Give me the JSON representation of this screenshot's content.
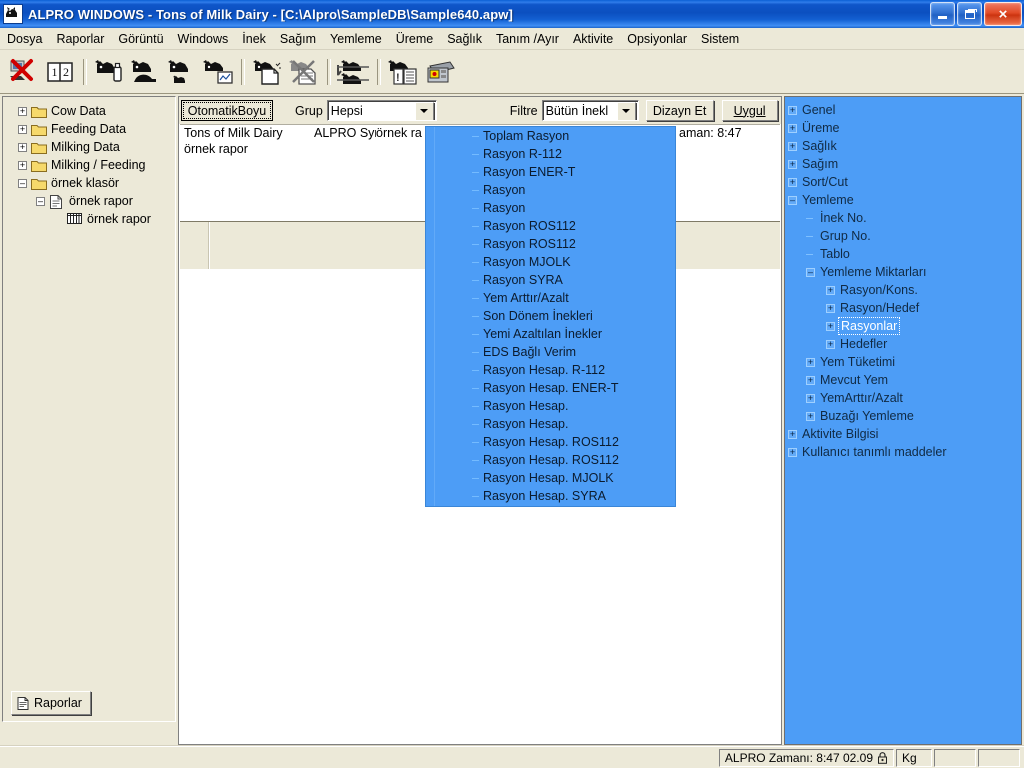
{
  "window": {
    "title": "ALPRO WINDOWS - Tons of Milk Dairy - [C:\\Alpro\\SampleDB\\Sample640.apw]",
    "icon": "alpro-cow-icon",
    "minimize_label": "",
    "maximize_label": "",
    "close_label": "×"
  },
  "menubar": {
    "items": [
      {
        "label": "Dosya"
      },
      {
        "label": "Raporlar"
      },
      {
        "label": "Görüntü"
      },
      {
        "label": "Windows"
      },
      {
        "label": "İnek"
      },
      {
        "label": "Sağım"
      },
      {
        "label": "Yemleme"
      },
      {
        "label": "Üreme"
      },
      {
        "label": "Sağlık"
      },
      {
        "label": "Tanım /Ayır"
      },
      {
        "label": "Aktivite"
      },
      {
        "label": "Opsiyonlar"
      },
      {
        "label": "Sistem"
      }
    ]
  },
  "toolbar": {
    "buttons": [
      {
        "name": "delete-report-icon"
      },
      {
        "name": "numbered-book-icon"
      },
      {
        "name": "cow-bottle-icon"
      },
      {
        "name": "cow-feed-icon"
      },
      {
        "name": "cow-calf-icon"
      },
      {
        "name": "cow-chart-icon"
      },
      {
        "name": "cow-new-document-icon"
      },
      {
        "name": "cow-delete-document-icon"
      },
      {
        "name": "cow-sort-icon"
      },
      {
        "name": "cow-report-list-icon"
      },
      {
        "name": "calculator-icon"
      }
    ]
  },
  "left_tree": {
    "nodes": [
      {
        "label": "Cow Data",
        "expander": "+",
        "type": "folder",
        "indent": 0
      },
      {
        "label": "Feeding Data",
        "expander": "+",
        "type": "folder",
        "indent": 0
      },
      {
        "label": "Milking Data",
        "expander": "+",
        "type": "folder",
        "indent": 0
      },
      {
        "label": "Milking / Feeding",
        "expander": "+",
        "type": "folder",
        "indent": 0
      },
      {
        "label": "örnek klasör",
        "expander": "–",
        "type": "folder",
        "indent": 0
      },
      {
        "label": "örnek rapor",
        "expander": "–",
        "type": "page",
        "indent": 1
      },
      {
        "label": "örnek rapor",
        "expander": "",
        "type": "grid",
        "indent": 2
      }
    ],
    "bottom_button": {
      "label": "Raporlar",
      "icon": "page-icon"
    }
  },
  "report_toolbar": {
    "autosize_button": "OtomatikBoyu",
    "group_label": "Grup",
    "group_value": "Hepsi",
    "filter_label": "Filtre",
    "filter_value": "Bütün İnekl",
    "design_button": "Dizayn Et",
    "apply_button": "Uygul"
  },
  "report_header": {
    "line1": [
      "Tons of Milk Dairy",
      "ALPRO Synı",
      "örnek ra",
      "aman: 8:47"
    ],
    "line2": "örnek rapor"
  },
  "dropdown": {
    "name": "report-field-list",
    "items": [
      "Toplam Rasyon",
      "Rasyon R-112",
      "Rasyon ENER-T",
      "Rasyon",
      "Rasyon",
      "Rasyon ROS112",
      "Rasyon ROS112",
      "Rasyon MJOLK",
      "Rasyon SYRA",
      "Yem Arttır/Azalt",
      "Son Dönem İnekleri",
      "Yemi Azaltılan İnekler",
      "EDS Bağlı Verim",
      "Rasyon Hesap. R-112",
      "Rasyon Hesap. ENER-T",
      "Rasyon Hesap.",
      "Rasyon Hesap.",
      "Rasyon Hesap. ROS112",
      "Rasyon Hesap. ROS112",
      "Rasyon Hesap. MJOLK",
      "Rasyon Hesap. SYRA"
    ]
  },
  "right_tree": {
    "nodes": [
      {
        "label": "Genel",
        "expander": "+",
        "indent": 0,
        "selected": false
      },
      {
        "label": "Üreme",
        "expander": "+",
        "indent": 0,
        "selected": false
      },
      {
        "label": "Sağlık",
        "expander": "+",
        "indent": 0,
        "selected": false
      },
      {
        "label": "Sağım",
        "expander": "+",
        "indent": 0,
        "selected": false
      },
      {
        "label": "Sort/Cut",
        "expander": "+",
        "indent": 0,
        "selected": false
      },
      {
        "label": "Yemleme",
        "expander": "–",
        "indent": 0,
        "selected": false
      },
      {
        "label": "İnek No.",
        "expander": "",
        "indent": 1,
        "selected": false
      },
      {
        "label": "Grup No.",
        "expander": "",
        "indent": 1,
        "selected": false
      },
      {
        "label": "Tablo",
        "expander": "",
        "indent": 1,
        "selected": false
      },
      {
        "label": "Yemleme Miktarları",
        "expander": "–",
        "indent": 1,
        "selected": false
      },
      {
        "label": "Rasyon/Kons.",
        "expander": "+",
        "indent": 2,
        "selected": false
      },
      {
        "label": "Rasyon/Hedef",
        "expander": "+",
        "indent": 2,
        "selected": false
      },
      {
        "label": "Rasyonlar",
        "expander": "+",
        "indent": 2,
        "selected": true
      },
      {
        "label": "Hedefler",
        "expander": "+",
        "indent": 2,
        "selected": false
      },
      {
        "label": "Yem Tüketimi",
        "expander": "+",
        "indent": 1,
        "selected": false
      },
      {
        "label": "Mevcut Yem",
        "expander": "+",
        "indent": 1,
        "selected": false
      },
      {
        "label": "YemArttır/Azalt",
        "expander": "+",
        "indent": 1,
        "selected": false
      },
      {
        "label": "Buzağı Yemleme",
        "expander": "+",
        "indent": 1,
        "selected": false
      },
      {
        "label": "Aktivite Bilgisi",
        "expander": "+",
        "indent": 0,
        "selected": false
      },
      {
        "label": "Kullanıcı tanımlı maddeler",
        "expander": "+",
        "indent": 0,
        "selected": false
      }
    ]
  },
  "statusbar": {
    "alpro_time": "ALPRO Zamanı: 8:47   02.09",
    "lock_icon": "lock-icon",
    "unit": "Kg",
    "cell_empty_1": "",
    "cell_empty_2": ""
  },
  "colors": {
    "title_blue": "#0b4fc0",
    "panel_beige": "#ece9d8",
    "tree_blue": "#4d9df6",
    "dropdown_blue": "#4d9df6",
    "selection_white": "#ffffff"
  }
}
